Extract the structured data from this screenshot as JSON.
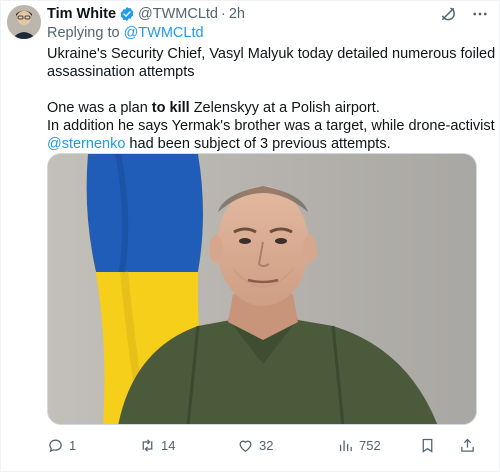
{
  "author": {
    "name": "Tim White",
    "handle": "@TWMCLtd",
    "separator": "·",
    "time": "2h"
  },
  "reply": {
    "prefix": "Replying to ",
    "to": "@TWMCLtd"
  },
  "content": {
    "line1": "Ukraine's Security Chief, Vasyl Malyuk today detailed numerous foiled",
    "line2": "assassination attempts",
    "line3_pre": "One was a plan ",
    "line3_bold": "to kill",
    "line3_post": " Zelenskyy at a Polish airport.",
    "line4": "In addition he says Yermak's brother was a target, while drone-activist",
    "line5_mention": "@sternenko",
    "line5_post": " had been subject of 3 previous attempts."
  },
  "stats": {
    "replies": "1",
    "reposts": "14",
    "likes": "32",
    "views": "752"
  },
  "colors": {
    "accent": "#1d9bf0",
    "muted": "#536471",
    "flag_blue": "#1f5db8",
    "flag_yellow": "#f6cf1a",
    "uniform": "#4b5a3b"
  }
}
